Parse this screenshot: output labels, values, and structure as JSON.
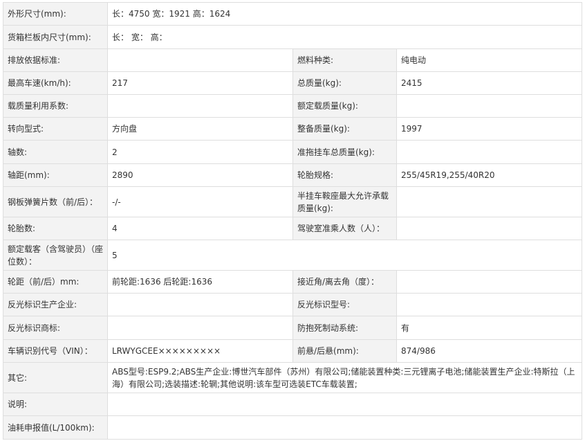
{
  "rows": [
    {
      "label": "外形尺寸(mm):",
      "value": "长：4750 宽：1921 高：1624"
    },
    {
      "label": "货箱栏板内尺寸(mm):",
      "value": "长： 宽： 高："
    },
    {
      "label": "排放依据标准:",
      "value": "",
      "label2": "燃料种类:",
      "value2": "纯电动"
    },
    {
      "label": "最高车速(km/h):",
      "value": "217",
      "label2": "总质量(kg):",
      "value2": "2415"
    },
    {
      "label": "载质量利用系数:",
      "value": "",
      "label2": "额定载质量(kg):",
      "value2": ""
    },
    {
      "label": "转向型式:",
      "value": "方向盘",
      "label2": "整备质量(kg):",
      "value2": "1997"
    },
    {
      "label": "轴数:",
      "value": "2",
      "label2": "准拖挂车总质量(kg):",
      "value2": ""
    },
    {
      "label": "轴距(mm):",
      "value": "2890",
      "label2": "轮胎规格:",
      "value2": "255/45R19,255/40R20"
    },
    {
      "label": "钢板弹簧片数（前/后）：",
      "value": "-/-",
      "label2": "半挂车鞍座最大允许承载质量(kg):",
      "value2": ""
    },
    {
      "label": "轮胎数:",
      "value": "4",
      "label2": "驾驶室准乘人数（人）：",
      "value2": ""
    },
    {
      "label": "额定载客（含驾驶员）（座位数）：",
      "value": "5"
    },
    {
      "label": "轮距（前/后）mm:",
      "value": "前轮距:1636 后轮距:1636",
      "label2": "接近角/离去角（度）：",
      "value2": ""
    },
    {
      "label": "反光标识生产企业:",
      "value": "",
      "label2": "反光标识型号:",
      "value2": ""
    },
    {
      "label": "反光标识商标:",
      "value": "",
      "label2": "防抱死制动系统:",
      "value2": "有"
    },
    {
      "label": "车辆识别代号（VIN）：",
      "value": "LRWYGCEE×××××××××",
      "label2": "前悬/后悬(mm):",
      "value2": "874/986"
    },
    {
      "label": "其它:",
      "value": "ABS型号:ESP9.2;ABS生产企业:博世汽车部件（苏州）有限公司;储能装置种类:三元锂离子电池;储能装置生产企业:特斯拉（上海）有限公司;选装描述:轮辋;其他说明:该车型可选装ETC车载装置;"
    },
    {
      "label": "说明:",
      "value": ""
    },
    {
      "label": "油耗申报值(L/100km):",
      "value": ""
    }
  ]
}
